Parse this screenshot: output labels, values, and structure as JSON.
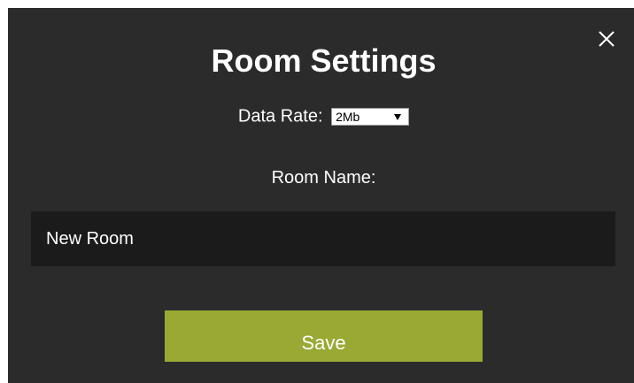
{
  "dialog": {
    "title": "Room Settings",
    "close_icon": "close-icon",
    "background_color": "#2b2b2b"
  },
  "data_rate": {
    "label": "Data Rate:",
    "selected": "2Mb",
    "arrow_icon": "triangle-down-icon"
  },
  "room_name": {
    "label": "Room Name:",
    "value": "New Room"
  },
  "save_button": {
    "label": "Save",
    "color": "#9aa934"
  }
}
